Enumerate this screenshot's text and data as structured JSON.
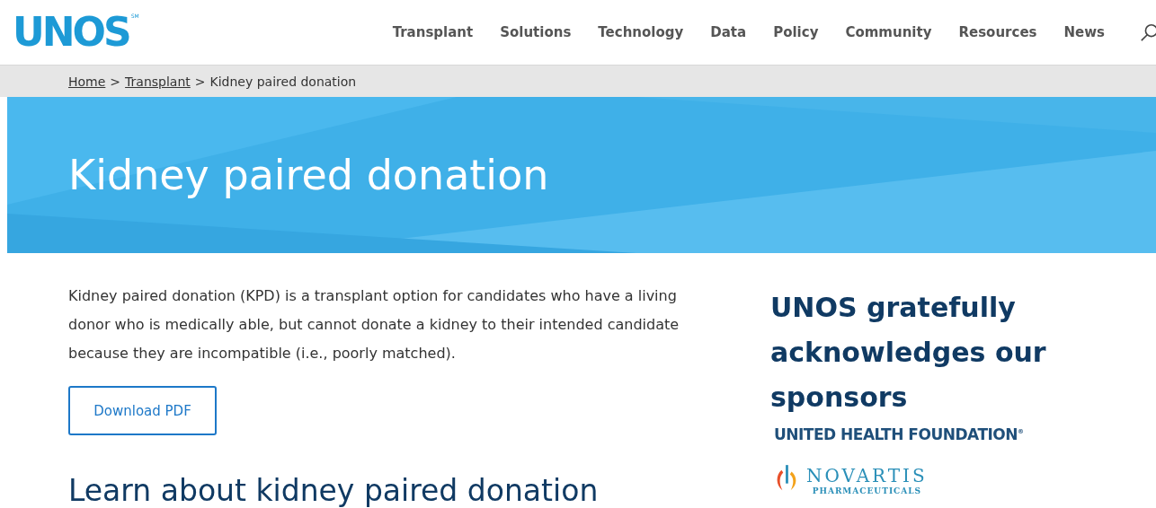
{
  "header": {
    "logo": {
      "text": "UNOS",
      "mark": "SM"
    },
    "nav": [
      {
        "label": "Transplant"
      },
      {
        "label": "Solutions"
      },
      {
        "label": "Technology"
      },
      {
        "label": "Data"
      },
      {
        "label": "Policy"
      },
      {
        "label": "Community"
      },
      {
        "label": "Resources"
      },
      {
        "label": "News"
      }
    ]
  },
  "breadcrumb": [
    {
      "label": "Home",
      "link": true
    },
    {
      "label": "Transplant",
      "link": true
    },
    {
      "label": "Kidney paired donation",
      "link": false
    }
  ],
  "breadcrumb_separator": ">",
  "hero": {
    "title": "Kidney paired donation"
  },
  "main": {
    "intro": "Kidney paired donation (KPD) is a transplant option for candidates who have a living donor who is medically able, but cannot donate a kidney to their intended candidate because they are incompatible (i.e., poorly matched).",
    "button": "Download PDF",
    "heading": "Learn about kidney paired donation"
  },
  "sidebar": {
    "heading": "UNOS gratefully acknowledges our sponsors",
    "sponsors": [
      {
        "kind": "wordmark",
        "name": "UNITED HEALTH FOUNDATION",
        "mark": "®"
      },
      {
        "kind": "flame",
        "name": "NOVARTIS",
        "sub": "PHARMACEUTICALS"
      }
    ]
  }
}
